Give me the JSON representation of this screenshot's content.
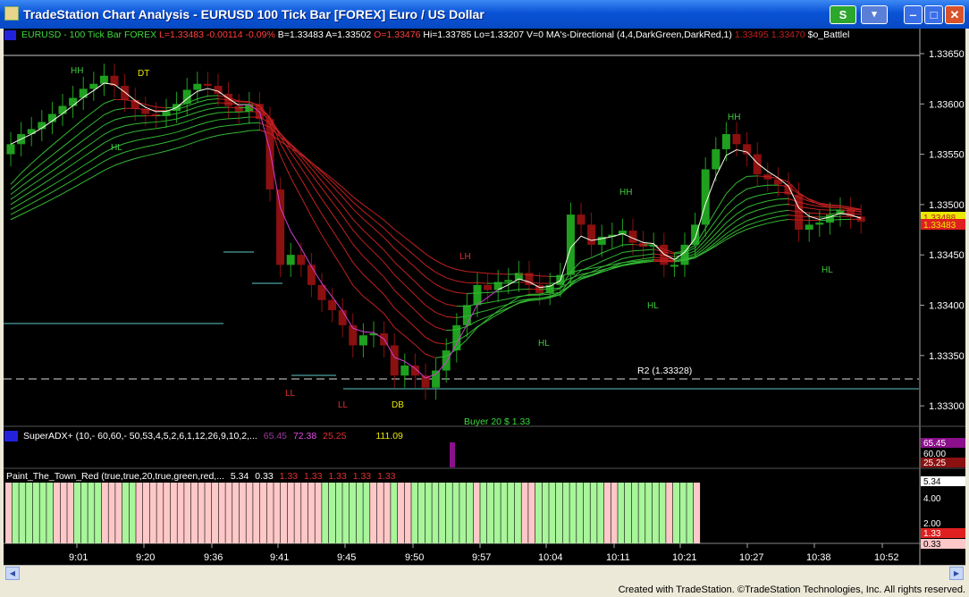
{
  "window": {
    "title": "TradeStation Chart Analysis - EURUSD 100 Tick Bar [FOREX] Euro / US Dollar",
    "s_button": "S",
    "tool_button": "▾",
    "min_glyph": "‒",
    "max_glyph": "□",
    "close_glyph": "✕"
  },
  "header": {
    "symbol": "EURUSD - 100 Tick Bar  FOREX",
    "low": "L=1.33483",
    "change": "-0.00114",
    "pct": "-0.09%",
    "bid": "B=1.33483",
    "ask": "A=1.33502",
    "open": "O=1.33476",
    "high": "Hi=1.33785",
    "lo": "Lo=1.33207",
    "volume": "V=0",
    "study": "MA's-Directional (4,4,DarkGreen,DarkRed,1)",
    "ma1": "1.33495",
    "ma2": "1.33470",
    "battle": "$o_Battlel"
  },
  "price_axis": [
    "1.33650",
    "1.33600",
    "1.33550",
    "1.33500",
    "1.33450",
    "1.33400",
    "1.33350",
    "1.33300"
  ],
  "last_price_tags": [
    "1.33488",
    "1.33483"
  ],
  "r2_label": "R2 (1.33328)",
  "swing_labels": [
    {
      "text": "HH",
      "color": "#3DCB3D"
    },
    {
      "text": "DT",
      "color": "#E8E800"
    },
    {
      "text": "HL",
      "color": "#3DCB3D"
    },
    {
      "text": "LL",
      "color": "#E03030"
    },
    {
      "text": "LL",
      "color": "#E03030"
    },
    {
      "text": "DB",
      "color": "#E8E800"
    },
    {
      "text": "LH",
      "color": "#E03030"
    },
    {
      "text": "HL",
      "color": "#3DCB3D"
    },
    {
      "text": "HH",
      "color": "#3DCB3D"
    },
    {
      "text": "HL",
      "color": "#3DCB3D"
    },
    {
      "text": "HH",
      "color": "#3DCB3D"
    },
    {
      "text": "HL",
      "color": "#3DCB3D"
    }
  ],
  "adx_panel": {
    "label": "SuperADX+ (10,- 60,60,- 50,53,4,5,2,6,1,12,26,9,10,2,...",
    "v1": "65.45",
    "v2": "72.38",
    "v3": "25.25",
    "v4": "111.09",
    "buyer": "Buyer 20 $ 1.33",
    "axis_tags": [
      "65.45",
      "60.00",
      "25.25"
    ]
  },
  "paint_panel": {
    "label": "Paint_The_Town_Red (true,true,20,true,green,red,...",
    "v1": "5.34",
    "v2": "0.33",
    "v3": "1.33",
    "v4": "1.33",
    "v5": "1.33",
    "v6": "1.33",
    "v7": "1.33",
    "axis_labels": [
      "5.34",
      "4.00",
      "2.00",
      "1.33",
      "0.33"
    ],
    "bars": "rggggggrrrggggrrrggrrrrrrrrrrrrrrrrrrrrrrrrrrrgggggggrrrgrrgggggggggrggggggrrggggggggggrrgggggggrgggr"
  },
  "time_axis": [
    "9:01",
    "9:20",
    "9:36",
    "9:41",
    "9:45",
    "9:50",
    "9:57",
    "10:04",
    "10:11",
    "10:21",
    "10:27",
    "10:38",
    "10:52"
  ],
  "footer": "Created with TradeStation. ©TradeStation Technologies, Inc. All rights reserved.",
  "colors": {
    "up_candle": "#1FA01F",
    "down_candle": "#8B1010",
    "paint_green": "#A8F59A",
    "paint_red": "#FFC8C8",
    "magenta_ma": "#D040D0",
    "cyan_line": "#5FC8C8"
  },
  "price_series": {
    "opens": [
      1.3355,
      1.3356,
      1.3357,
      1.33575,
      1.33582,
      1.3359,
      1.33598,
      1.33606,
      1.33615,
      1.3362,
      1.33628,
      1.33618,
      1.33604,
      1.33595,
      1.3359,
      1.33588,
      1.33593,
      1.336,
      1.33614,
      1.3362,
      1.33618,
      1.3361,
      1.33598,
      1.33592,
      1.336,
      1.33585,
      1.33515,
      1.3344,
      1.3345,
      1.3344,
      1.3342,
      1.33405,
      1.33395,
      1.3338,
      1.3336,
      1.3337,
      1.33372,
      1.3336,
      1.3333,
      1.3334,
      1.3333,
      1.33318,
      1.33335,
      1.33355,
      1.3338,
      1.334,
      1.3342,
      1.33415,
      1.33423,
      1.33425,
      1.33432,
      1.3342,
      1.33412,
      1.3342,
      1.3343,
      1.3349,
      1.3348,
      1.3346,
      1.33468,
      1.3347,
      1.33474,
      1.33462,
      1.33458,
      1.3346,
      1.3344,
      1.3344,
      1.3346,
      1.3348,
      1.33535,
      1.33555,
      1.3357,
      1.3356,
      1.3355,
      1.3353,
      1.33525,
      1.3352,
      1.3351,
      1.33475,
      1.3348,
      1.33482,
      1.3349,
      1.33495,
      1.33488
    ],
    "closes": [
      1.3356,
      1.3357,
      1.33575,
      1.33582,
      1.3359,
      1.33598,
      1.33606,
      1.33615,
      1.3362,
      1.33628,
      1.33618,
      1.33604,
      1.33595,
      1.3359,
      1.33588,
      1.33593,
      1.336,
      1.33614,
      1.3362,
      1.33618,
      1.3361,
      1.33598,
      1.33592,
      1.336,
      1.33585,
      1.33515,
      1.3344,
      1.3345,
      1.3344,
      1.3342,
      1.33405,
      1.33395,
      1.3338,
      1.3336,
      1.3337,
      1.33372,
      1.3336,
      1.3333,
      1.3334,
      1.3333,
      1.33318,
      1.33335,
      1.33355,
      1.3338,
      1.334,
      1.3342,
      1.33415,
      1.33423,
      1.33425,
      1.33432,
      1.3342,
      1.33412,
      1.3342,
      1.3343,
      1.3349,
      1.3348,
      1.3346,
      1.33468,
      1.3347,
      1.33474,
      1.33462,
      1.33458,
      1.3346,
      1.3344,
      1.3344,
      1.3346,
      1.3348,
      1.33535,
      1.33555,
      1.3357,
      1.3356,
      1.3355,
      1.3353,
      1.33525,
      1.3352,
      1.3351,
      1.33475,
      1.3348,
      1.33482,
      1.3349,
      1.33495,
      1.33488,
      1.33483
    ]
  }
}
